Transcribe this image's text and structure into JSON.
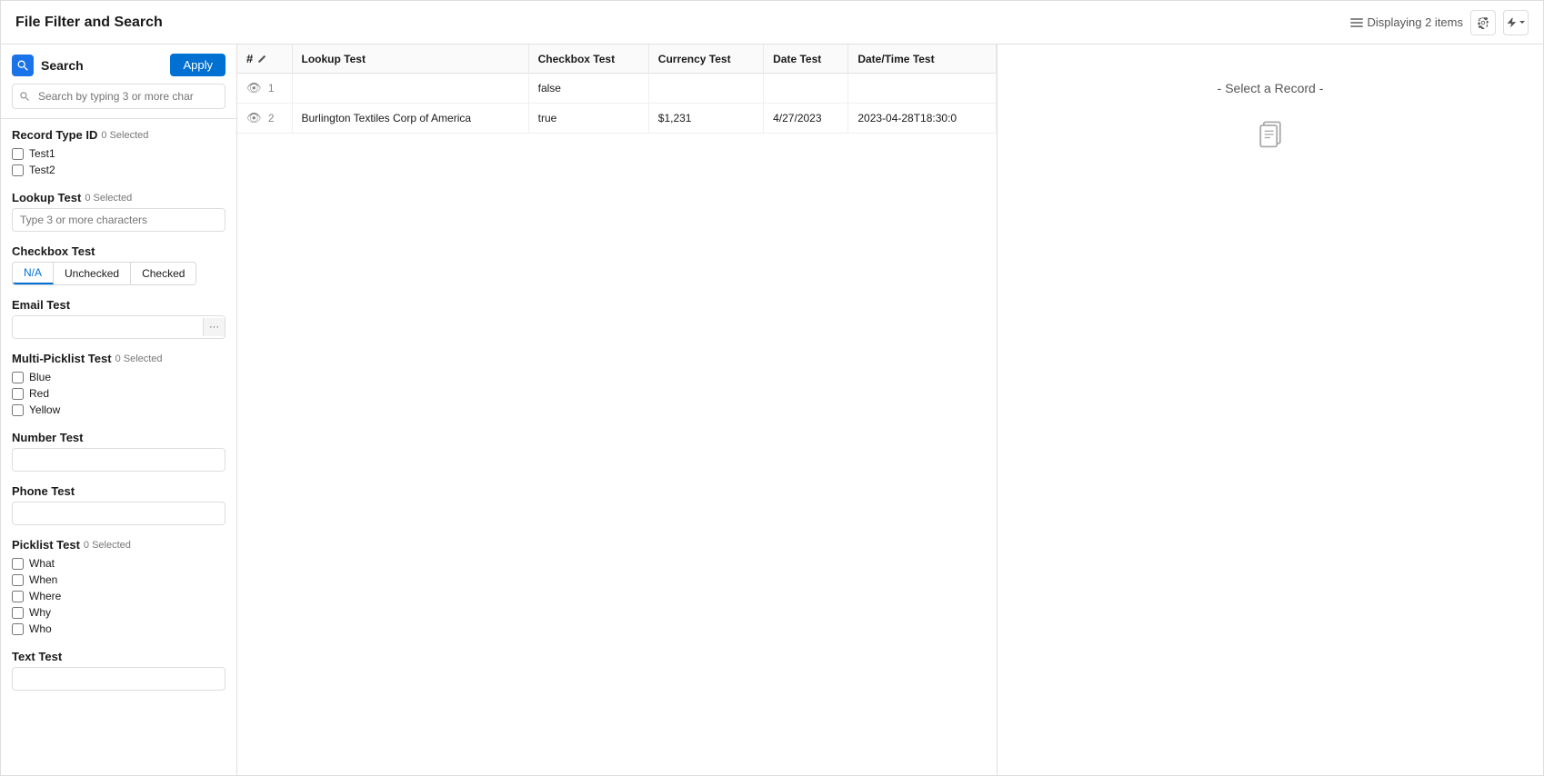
{
  "header": {
    "title": "File Filter and Search",
    "displaying": "Displaying 2 items"
  },
  "left_panel": {
    "search_label": "Search",
    "apply_label": "Apply",
    "search_placeholder": "Search by typing 3 or more char",
    "record_type_id": {
      "label": "Record Type ID",
      "sublabel": "0 Selected",
      "options": [
        "Test1",
        "Test2"
      ]
    },
    "lookup_test": {
      "label": "Lookup Test",
      "sublabel": "0 Selected",
      "placeholder": "Type 3 or more characters"
    },
    "checkbox_test": {
      "label": "Checkbox Test",
      "options": [
        "N/A",
        "Unchecked",
        "Checked"
      ],
      "active": "N/A"
    },
    "email_test": {
      "label": "Email Test",
      "placeholder": "",
      "btn_label": "···"
    },
    "multi_picklist_test": {
      "label": "Multi-Picklist Test",
      "sublabel": "0 Selected",
      "options": [
        "Blue",
        "Red",
        "Yellow"
      ]
    },
    "number_test": {
      "label": "Number Test",
      "placeholder": ""
    },
    "phone_test": {
      "label": "Phone Test",
      "placeholder": ""
    },
    "picklist_test": {
      "label": "Picklist Test",
      "sublabel": "0 Selected",
      "options": [
        "What",
        "When",
        "Where",
        "Why",
        "Who"
      ]
    },
    "text_test": {
      "label": "Text Test",
      "placeholder": ""
    }
  },
  "table": {
    "columns": [
      "#",
      "Lookup Test",
      "Checkbox Test",
      "Currency Test",
      "Date Test",
      "Date/Time Test"
    ],
    "rows": [
      {
        "num": "1",
        "lookup": "",
        "checkbox": "false",
        "currency": "",
        "date": "",
        "datetime": ""
      },
      {
        "num": "2",
        "lookup": "Burlington Textiles Corp of America",
        "checkbox": "true",
        "currency": "$1,231",
        "date": "4/27/2023",
        "datetime": "2023-04-28T18:30:0"
      }
    ]
  },
  "right_panel": {
    "select_text": "- Select a Record -"
  }
}
